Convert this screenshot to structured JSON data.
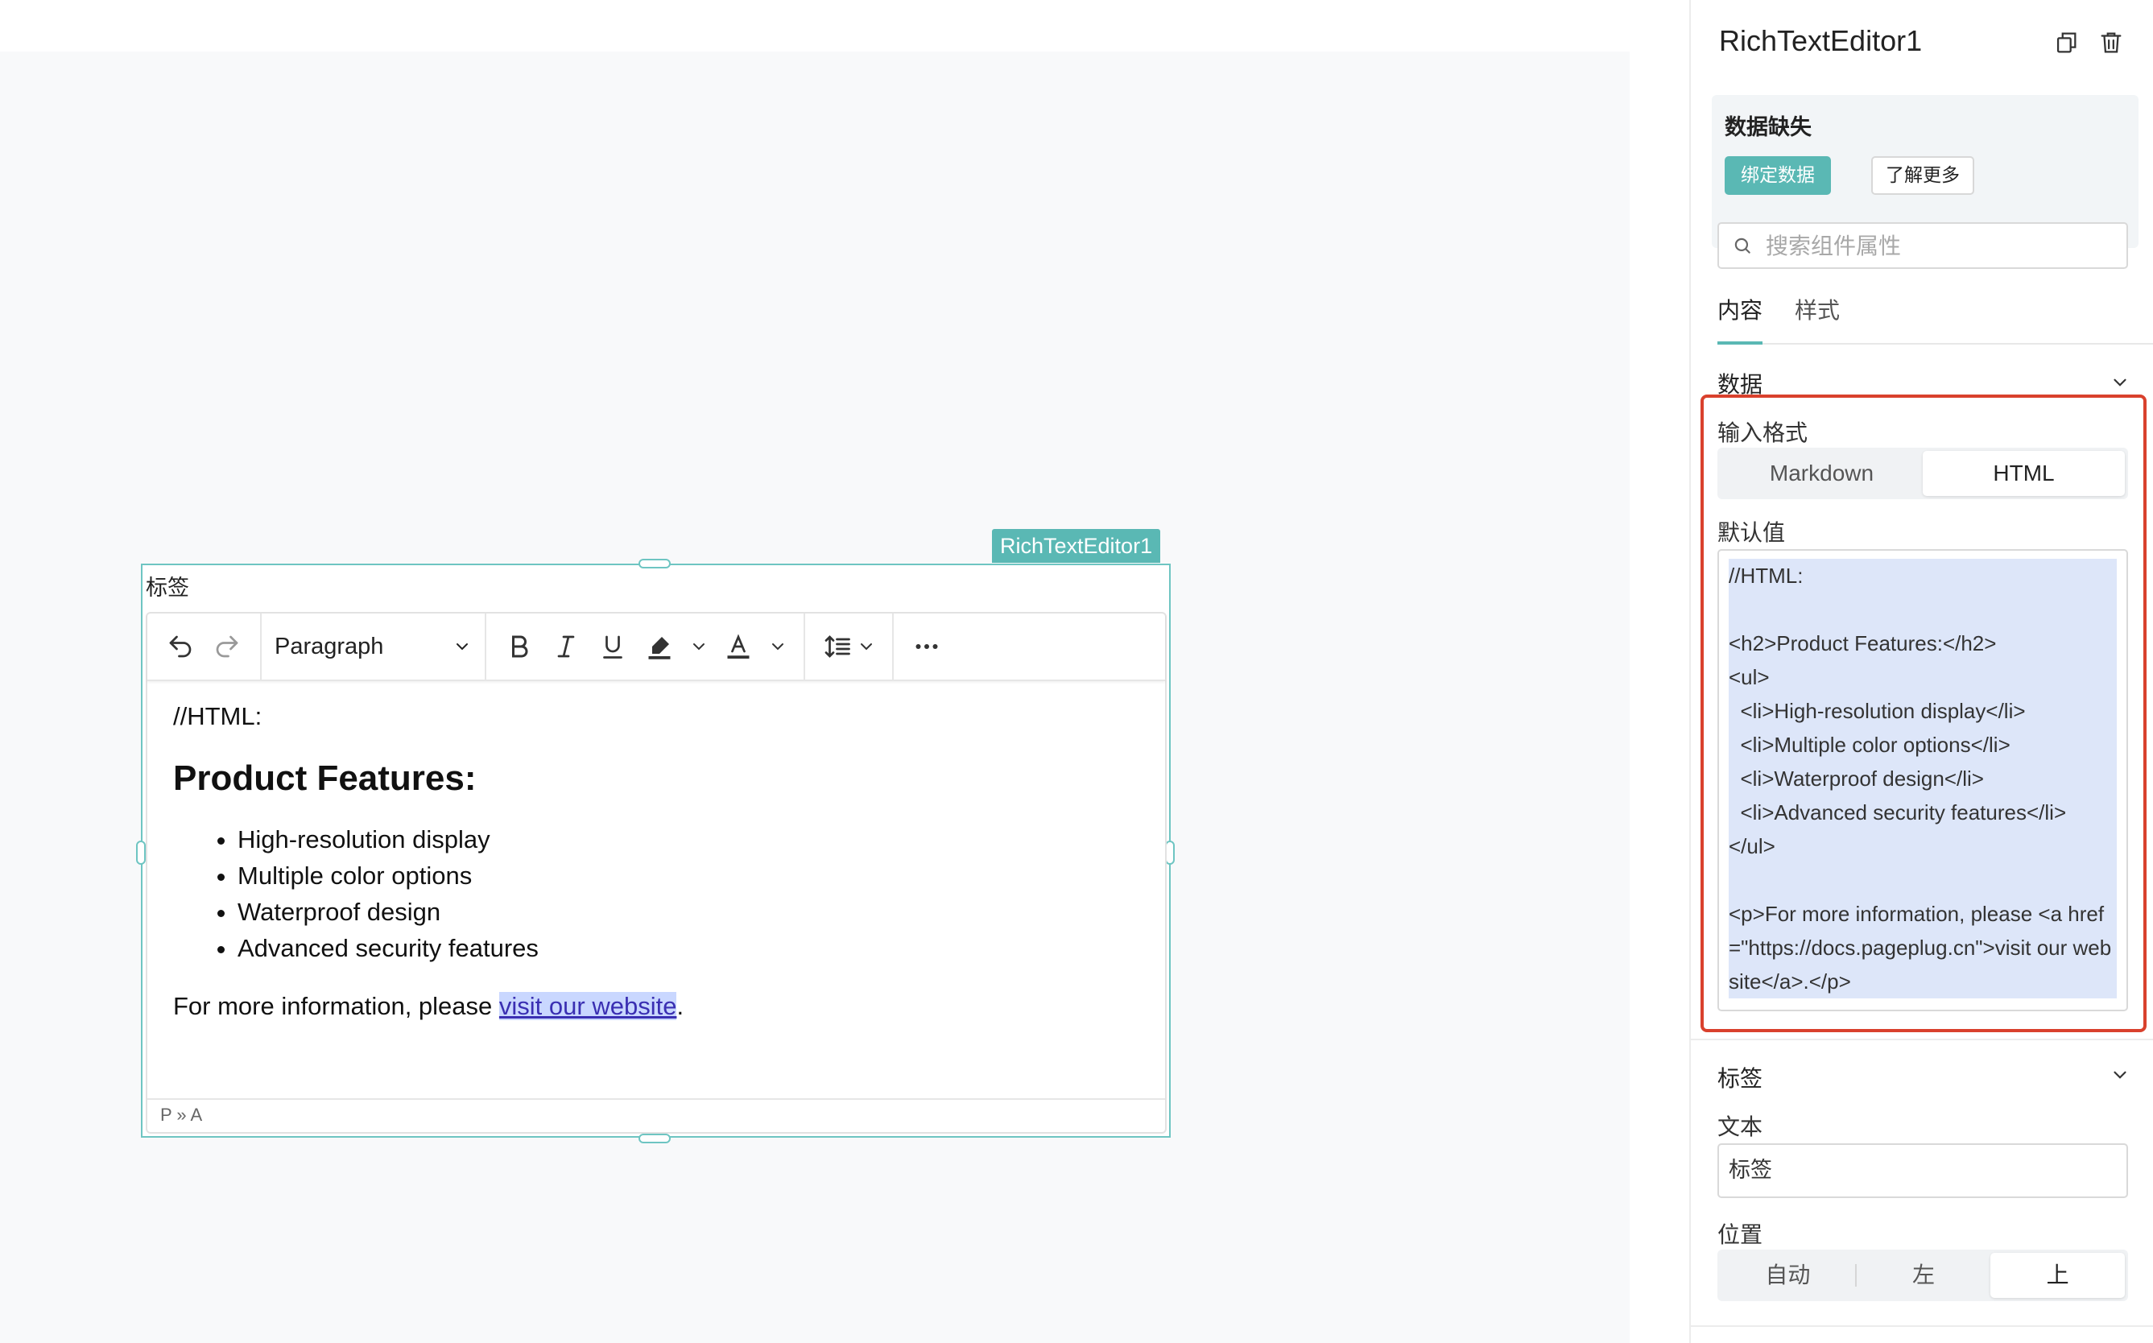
{
  "canvas": {
    "widget_name": "RichTextEditor1",
    "field_label": "标签",
    "toolbar": {
      "block_format": "Paragraph"
    },
    "content": {
      "line1": "//HTML:",
      "heading": "Product Features:",
      "items": [
        "High-resolution display",
        "Multiple color options",
        "Waterproof design",
        "Advanced security features"
      ],
      "para_prefix": "For more information, please ",
      "link_text": "visit our website",
      "para_suffix": "."
    },
    "statusbar": "P » A"
  },
  "panel": {
    "title": "RichTextEditor1",
    "warning": {
      "title": "数据缺失",
      "bind_button": "绑定数据",
      "learn_button": "了解更多"
    },
    "search_placeholder": "搜索组件属性",
    "tabs": [
      "内容",
      "样式"
    ],
    "data_section": {
      "title": "数据",
      "input_format_label": "输入格式",
      "formats": [
        "Markdown",
        "HTML"
      ],
      "selected_format": "HTML",
      "default_label": "默认值",
      "default_value": "//HTML:\n\n<h2>Product Features:</h2>\n<ul>\n  <li>High-resolution display</li>\n  <li>Multiple color options</li>\n  <li>Waterproof design</li>\n  <li>Advanced security features</li>\n</ul>\n\n<p>For more information, please <a href=\"https://docs.pageplug.cn\">visit our website</a>.</p>"
    },
    "label_section": {
      "title": "标签",
      "text_label": "文本",
      "text_value": "标签",
      "position_label": "位置",
      "positions": [
        "自动",
        "左",
        "上"
      ],
      "selected_position": "上"
    }
  },
  "colors": {
    "accent": "#5ab8b4",
    "highlight_border": "#d9412d",
    "selection": "#dde6f9"
  }
}
